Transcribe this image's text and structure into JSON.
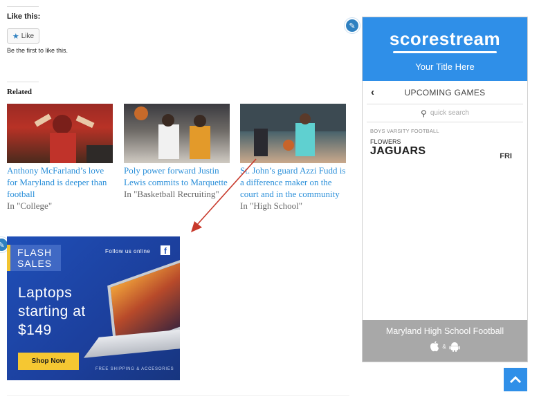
{
  "likes": {
    "heading": "Like this:",
    "button_label": "Like",
    "first_text": "Be the first to like this."
  },
  "related": {
    "heading": "Related",
    "items": [
      {
        "title": "Anthony McFarland’s love for Maryland is deeper than football",
        "category": "In \"College\""
      },
      {
        "title": "Poly power forward Justin Lewis commits to Marquette",
        "category": "In \"Basketball Recruiting\""
      },
      {
        "title": "St. John’s guard Azzi Fudd is a difference maker on the court and in the community",
        "category": "In \"High School\""
      }
    ]
  },
  "ad": {
    "badge_line1": "FLASH",
    "badge_line2": "SALES",
    "follow_text": "Follow us online",
    "headline": "Laptops starting at $149",
    "cta_label": "Shop Now",
    "shipping_text": "FREE SHIPPING & ACCESORIES",
    "accent_color": "#f5c732",
    "background_color": "#1f4fb8"
  },
  "scorestream": {
    "logo": "scorestream",
    "subtitle": "Your Title Here",
    "section_title": "UPCOMING GAMES",
    "search_placeholder": "quick search",
    "league": "BOYS VARSITY FOOTBALL",
    "game": {
      "team_small": "FLOWERS",
      "team_big": "JAGUARS",
      "day": "FRI"
    },
    "footer_title": "Maryland High School Football",
    "store_separator": "&",
    "brand_color": "#2f8fe8",
    "footer_color": "#a8a8a8"
  },
  "icons": {
    "edit": "pencil-icon",
    "like": "star-icon",
    "back": "chevron-left-icon",
    "search": "search-icon",
    "facebook": "facebook-icon",
    "apple": "apple-icon",
    "android": "android-icon",
    "scroll_top": "chevron-up-icon"
  },
  "link_color": "#2a8fd9"
}
